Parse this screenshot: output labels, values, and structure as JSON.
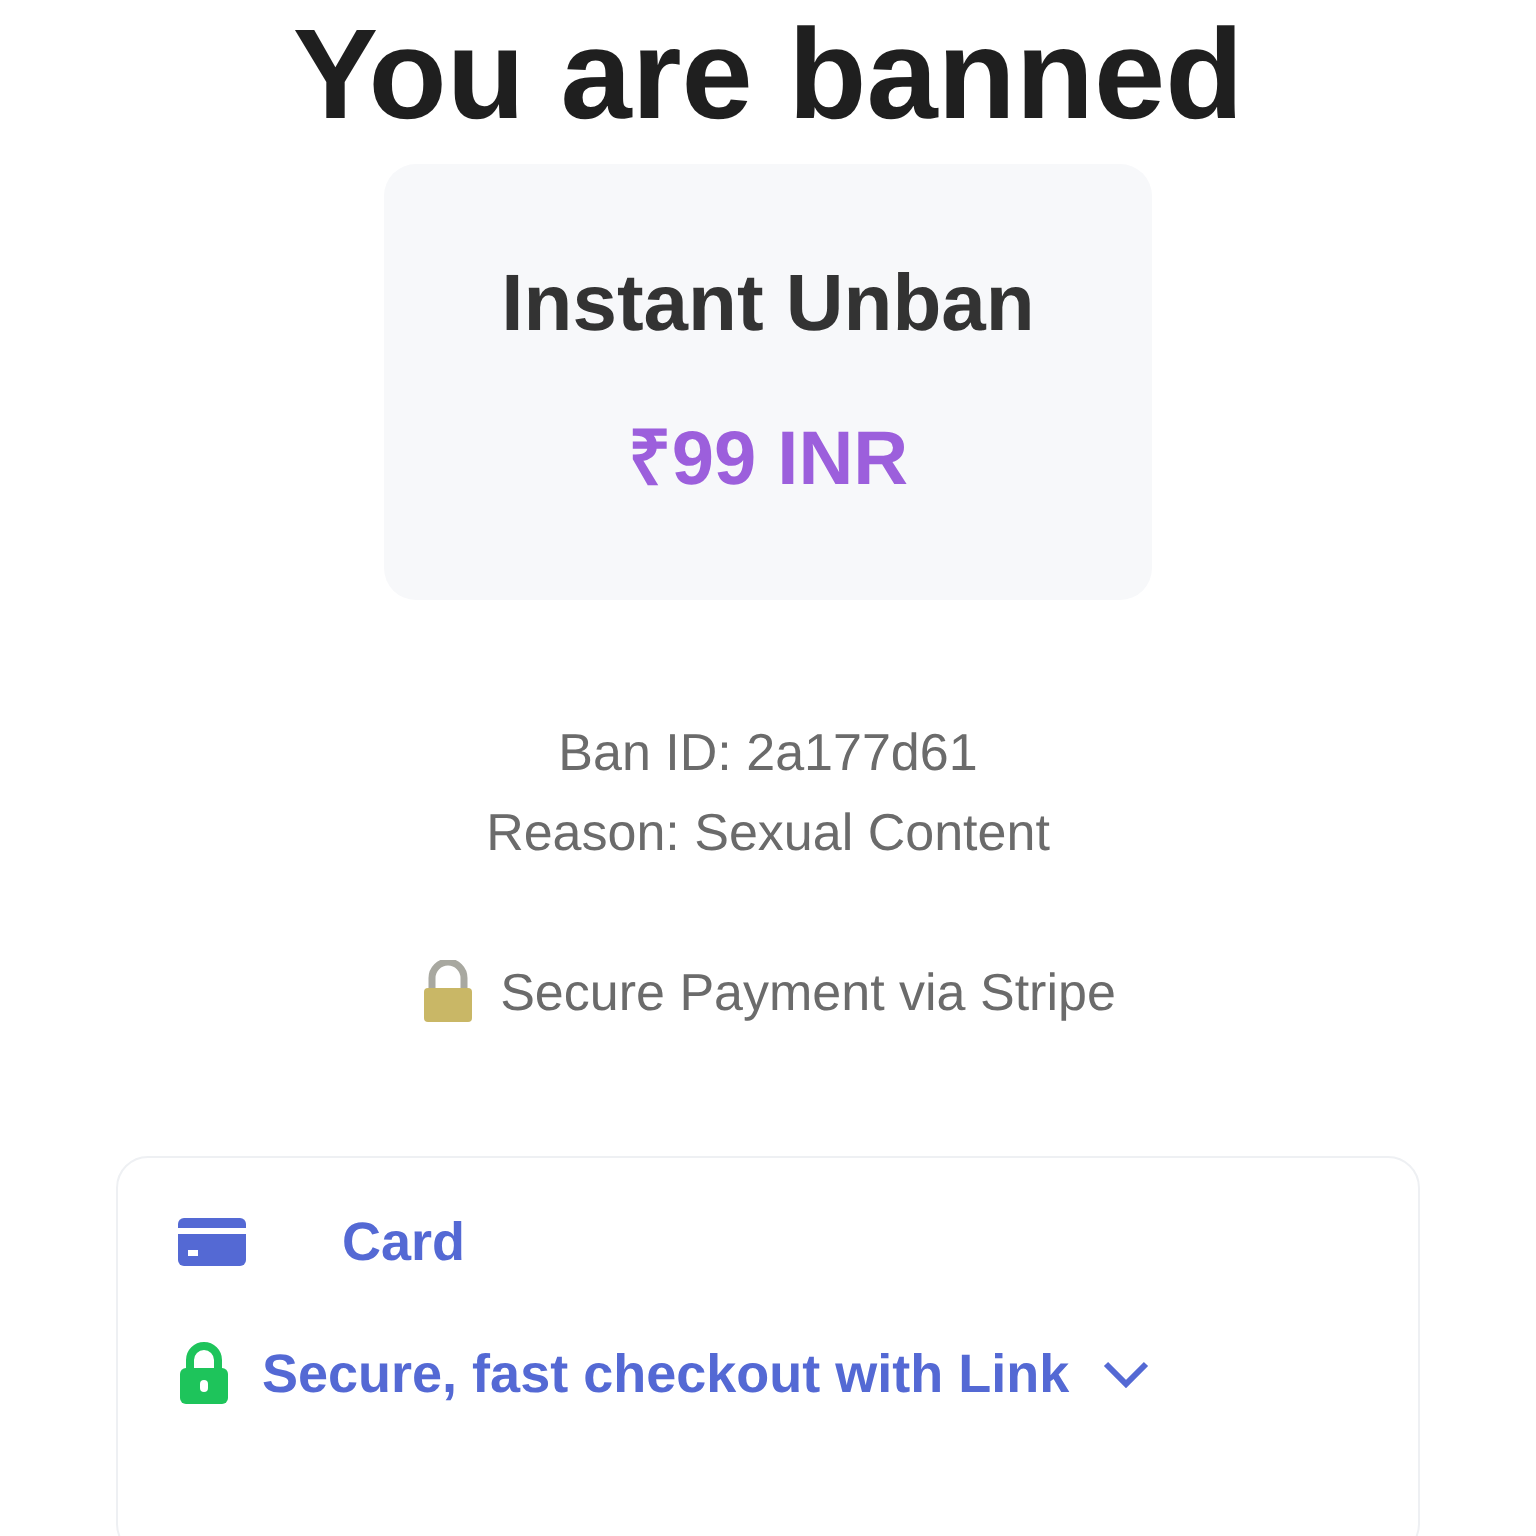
{
  "title": "You are banned",
  "offer": {
    "name": "Instant Unban",
    "price": "₹99 INR"
  },
  "ban_info": [
    "Ban ID: 2a177d61",
    "Reason: Sexual Content"
  ],
  "secure_note": "Secure Payment via Stripe",
  "payment": {
    "method": "Card",
    "link": "Secure, fast checkout with Link"
  }
}
